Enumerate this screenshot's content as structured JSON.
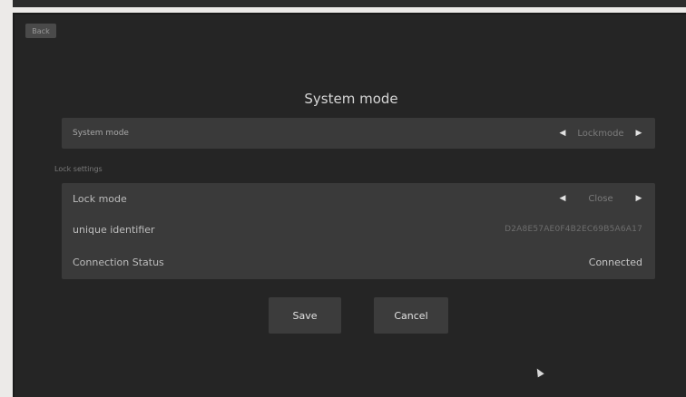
{
  "header": {
    "back_label": "Back"
  },
  "title": "System mode",
  "system_mode": {
    "label": "System mode",
    "value": "Lockmode"
  },
  "lock_settings": {
    "section_label": "Lock settings",
    "lock_mode": {
      "label": "Lock mode",
      "value": "Close"
    },
    "unique_identifier": {
      "label": "unique identifier",
      "value": "D2A8E57AE0F4B2EC69B5A6A17"
    },
    "connection_status": {
      "label": "Connection Status",
      "value": "Connected"
    }
  },
  "buttons": {
    "save": "Save",
    "cancel": "Cancel"
  },
  "icons": {
    "left_arrow": "triangle-left",
    "right_arrow": "triangle-right",
    "cursor": "mouse-pointer"
  }
}
